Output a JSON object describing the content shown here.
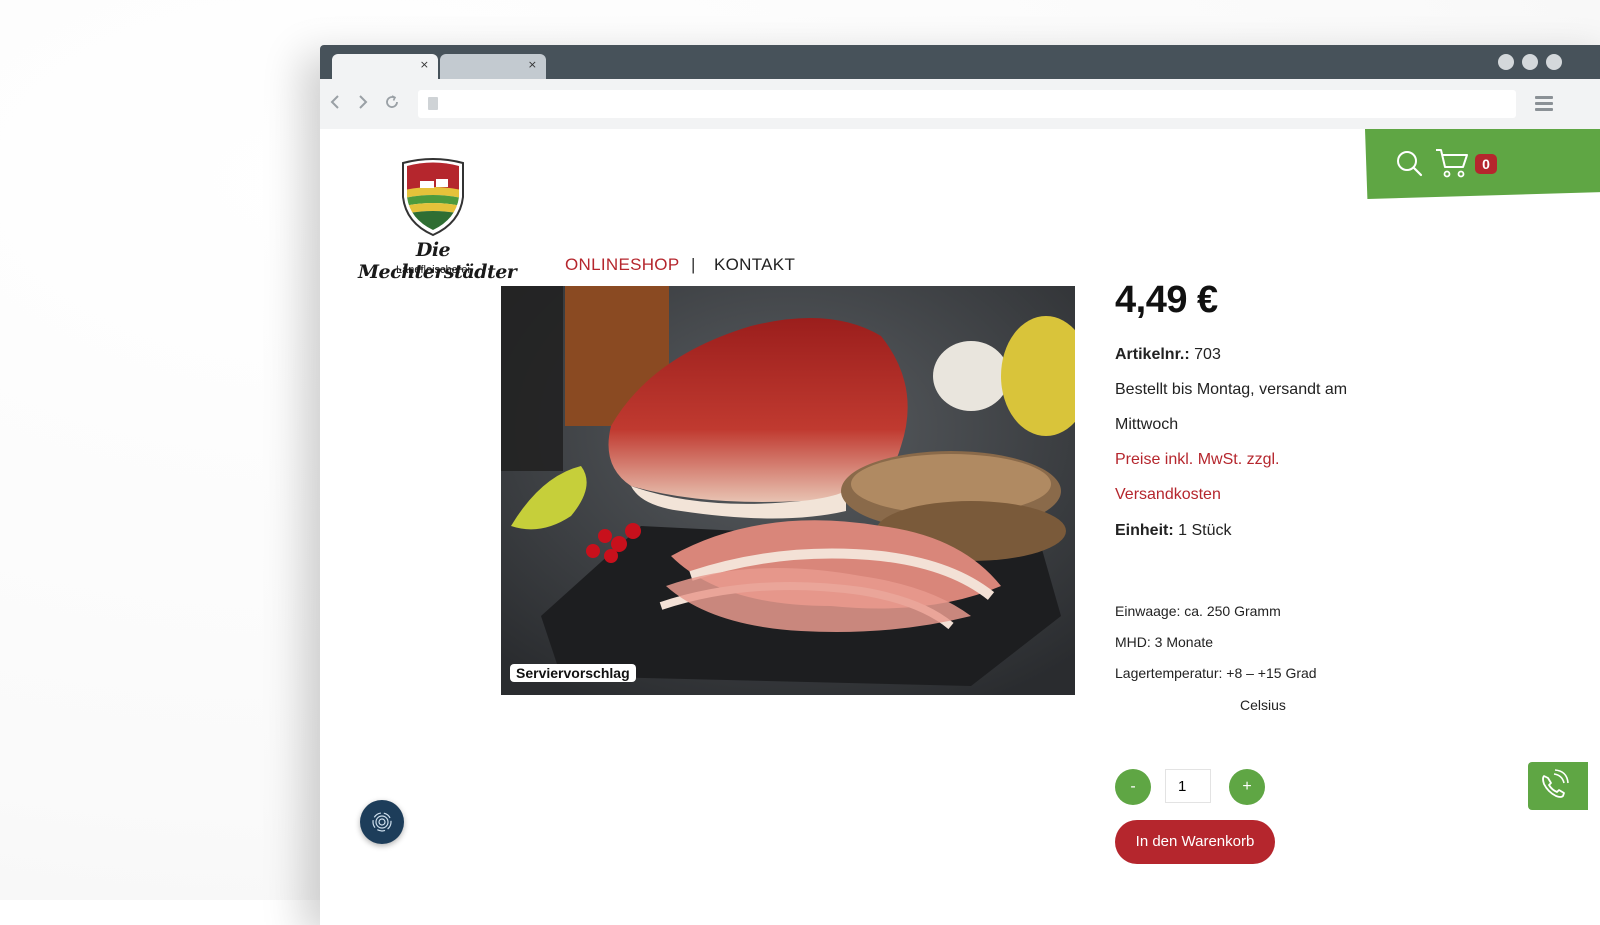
{
  "browser": {
    "tabs": [
      {
        "close": "×"
      },
      {
        "close": "×"
      }
    ]
  },
  "header": {
    "cart_count": "0",
    "logo": {
      "name": "Die Mechterstädter",
      "subtitle": "Landfleischerei"
    },
    "nav": [
      {
        "label": "ONLINESHOP",
        "active": true
      },
      {
        "label": "KONTAKT",
        "active": false
      }
    ],
    "nav_separator": "|"
  },
  "product": {
    "image_label": "Serviervorschlag",
    "price": "4,49 €",
    "article_label": "Artikelnr.:",
    "article_value": "703",
    "shipping_line1": "Bestellt bis Montag, versandt am",
    "shipping_line2": "Mittwoch",
    "tax_line1": "Preise inkl. MwSt. zzgl.",
    "tax_line2": "Versandkosten",
    "unit_label": "Einheit:",
    "unit_value": "1 Stück",
    "weight": "Einwaage: ca. 250 Gramm",
    "mhd": "MHD: 3 Monate",
    "storage_line1": "Lagertemperatur: +8 – +15 Grad",
    "storage_line2": "Celsius",
    "quantity": "1",
    "minus_label": "-",
    "plus_label": "+",
    "add_to_cart": "In den Warenkorb"
  },
  "colors": {
    "brand_red": "#b5262d",
    "brand_green": "#5fa644",
    "tab_bar": "#47525a"
  }
}
